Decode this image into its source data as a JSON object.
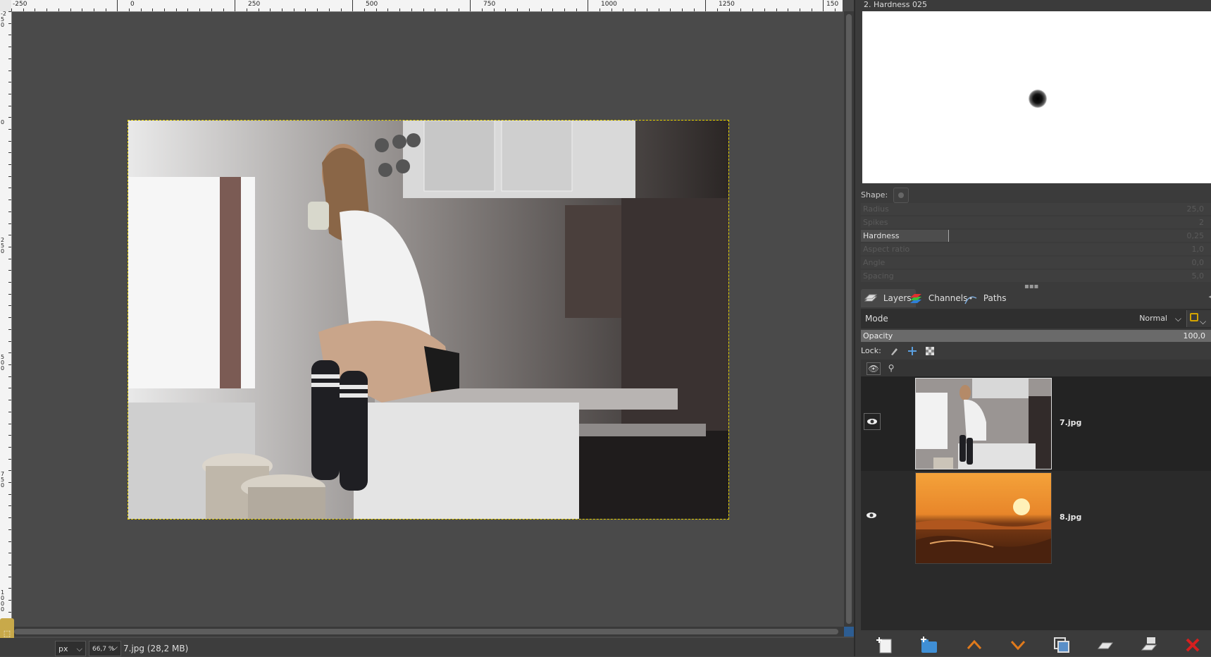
{
  "canvas": {
    "ruler_top_labels": [
      "-250",
      "0",
      "250",
      "500",
      "750",
      "1000",
      "1250",
      "150"
    ],
    "ruler_left_labels": [
      "-250",
      "0",
      "250",
      "500",
      "750",
      "1000"
    ],
    "image_name": "7.jpg"
  },
  "statusbar": {
    "unit": "px",
    "zoom": "66,7 %",
    "info": "7.jpg (28,2 MB)"
  },
  "brush": {
    "title": "2. Hardness 025",
    "shape_label": "Shape:",
    "params": [
      {
        "label": "Radius",
        "value": "25,0"
      },
      {
        "label": "Spikes",
        "value": "2"
      },
      {
        "label": "Hardness",
        "value": "0,25"
      },
      {
        "label": "Aspect ratio",
        "value": "1,0"
      },
      {
        "label": "Angle",
        "value": "0,0"
      },
      {
        "label": "Spacing",
        "value": "5,0"
      }
    ],
    "hardness_fraction": 0.25
  },
  "tabs": [
    {
      "label": "Layers",
      "icon": "layers-icon"
    },
    {
      "label": "Channels",
      "icon": "channels-icon"
    },
    {
      "label": "Paths",
      "icon": "paths-icon"
    }
  ],
  "layers_panel": {
    "mode_label": "Mode",
    "mode_value": "Normal",
    "opacity_label": "Opacity",
    "opacity_value": "100,0",
    "opacity_fraction": 1.0,
    "lock_label": "Lock:",
    "layers": [
      {
        "name": "7.jpg",
        "visible": true,
        "selected": true
      },
      {
        "name": "8.jpg",
        "visible": true,
        "selected": false
      }
    ]
  },
  "colors": {
    "accent": "#e8d300",
    "delete": "#d61f1f",
    "move_up": "#e07a1c",
    "folder": "#3f8fd6"
  }
}
